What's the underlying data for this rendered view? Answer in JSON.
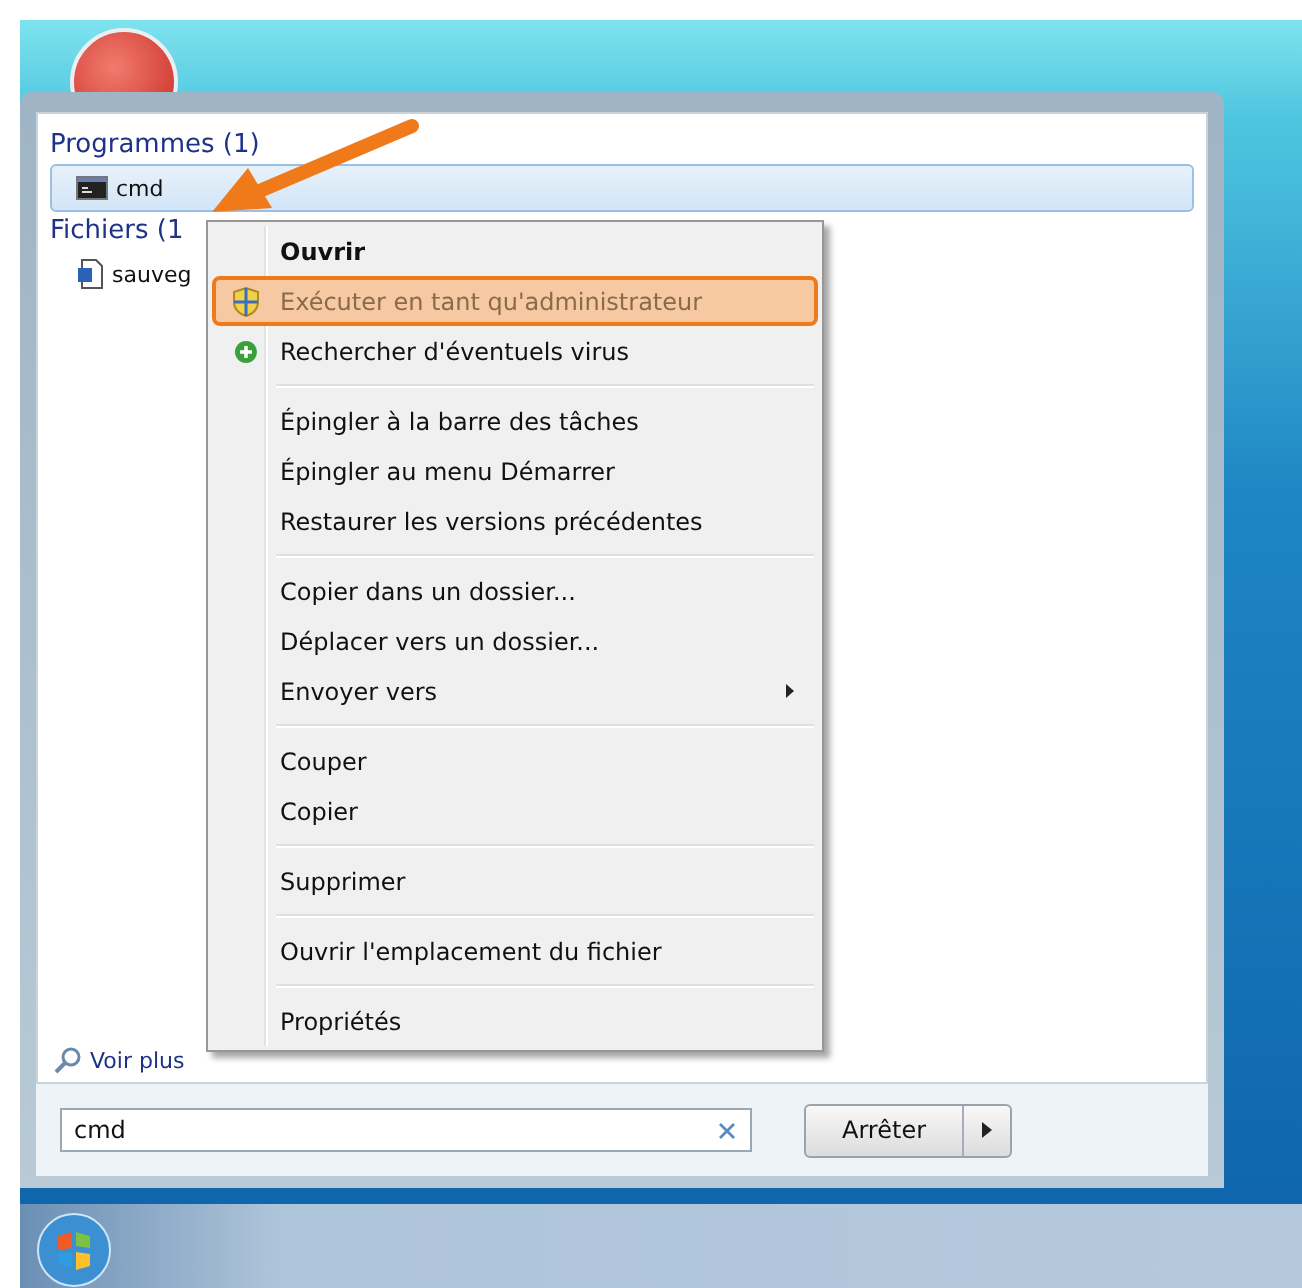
{
  "start_menu": {
    "sections": [
      {
        "title": "Programmes (1)",
        "items": [
          {
            "label": "cmd",
            "kind": "program",
            "selected": true
          }
        ]
      },
      {
        "title": "Fichiers (1",
        "items": [
          {
            "label": "sauveg",
            "kind": "file",
            "selected": false
          }
        ]
      }
    ],
    "see_more": "Voir plus",
    "search": {
      "value": "cmd"
    },
    "shutdown_button": "Arrêter"
  },
  "context_menu": {
    "groups": [
      [
        {
          "label": "Ouvrir",
          "default": true,
          "selected": false,
          "submenu": false
        },
        {
          "label": "Exécuter en tant qu'administrateur",
          "default": false,
          "selected": true,
          "submenu": false
        },
        {
          "label": "Rechercher d'éventuels virus",
          "default": false,
          "selected": false,
          "submenu": false
        }
      ],
      [
        {
          "label": "Épingler à la barre des tâches",
          "default": false,
          "selected": false,
          "submenu": false
        },
        {
          "label": "Épingler au menu Démarrer",
          "default": false,
          "selected": false,
          "submenu": false
        },
        {
          "label": "Restaurer les versions précédentes",
          "default": false,
          "selected": false,
          "submenu": false
        }
      ],
      [
        {
          "label": "Copier dans un dossier...",
          "default": false,
          "selected": false,
          "submenu": false
        },
        {
          "label": "Déplacer vers un dossier...",
          "default": false,
          "selected": false,
          "submenu": false
        },
        {
          "label": "Envoyer vers",
          "default": false,
          "selected": false,
          "submenu": true
        }
      ],
      [
        {
          "label": "Couper",
          "default": false,
          "selected": false,
          "submenu": false
        },
        {
          "label": "Copier",
          "default": false,
          "selected": false,
          "submenu": false
        }
      ],
      [
        {
          "label": "Supprimer",
          "default": false,
          "selected": false,
          "submenu": false
        }
      ],
      [
        {
          "label": "Ouvrir l'emplacement du fichier",
          "default": false,
          "selected": false,
          "submenu": false
        }
      ],
      [
        {
          "label": "Propriétés",
          "default": false,
          "selected": false,
          "submenu": false
        }
      ]
    ]
  }
}
